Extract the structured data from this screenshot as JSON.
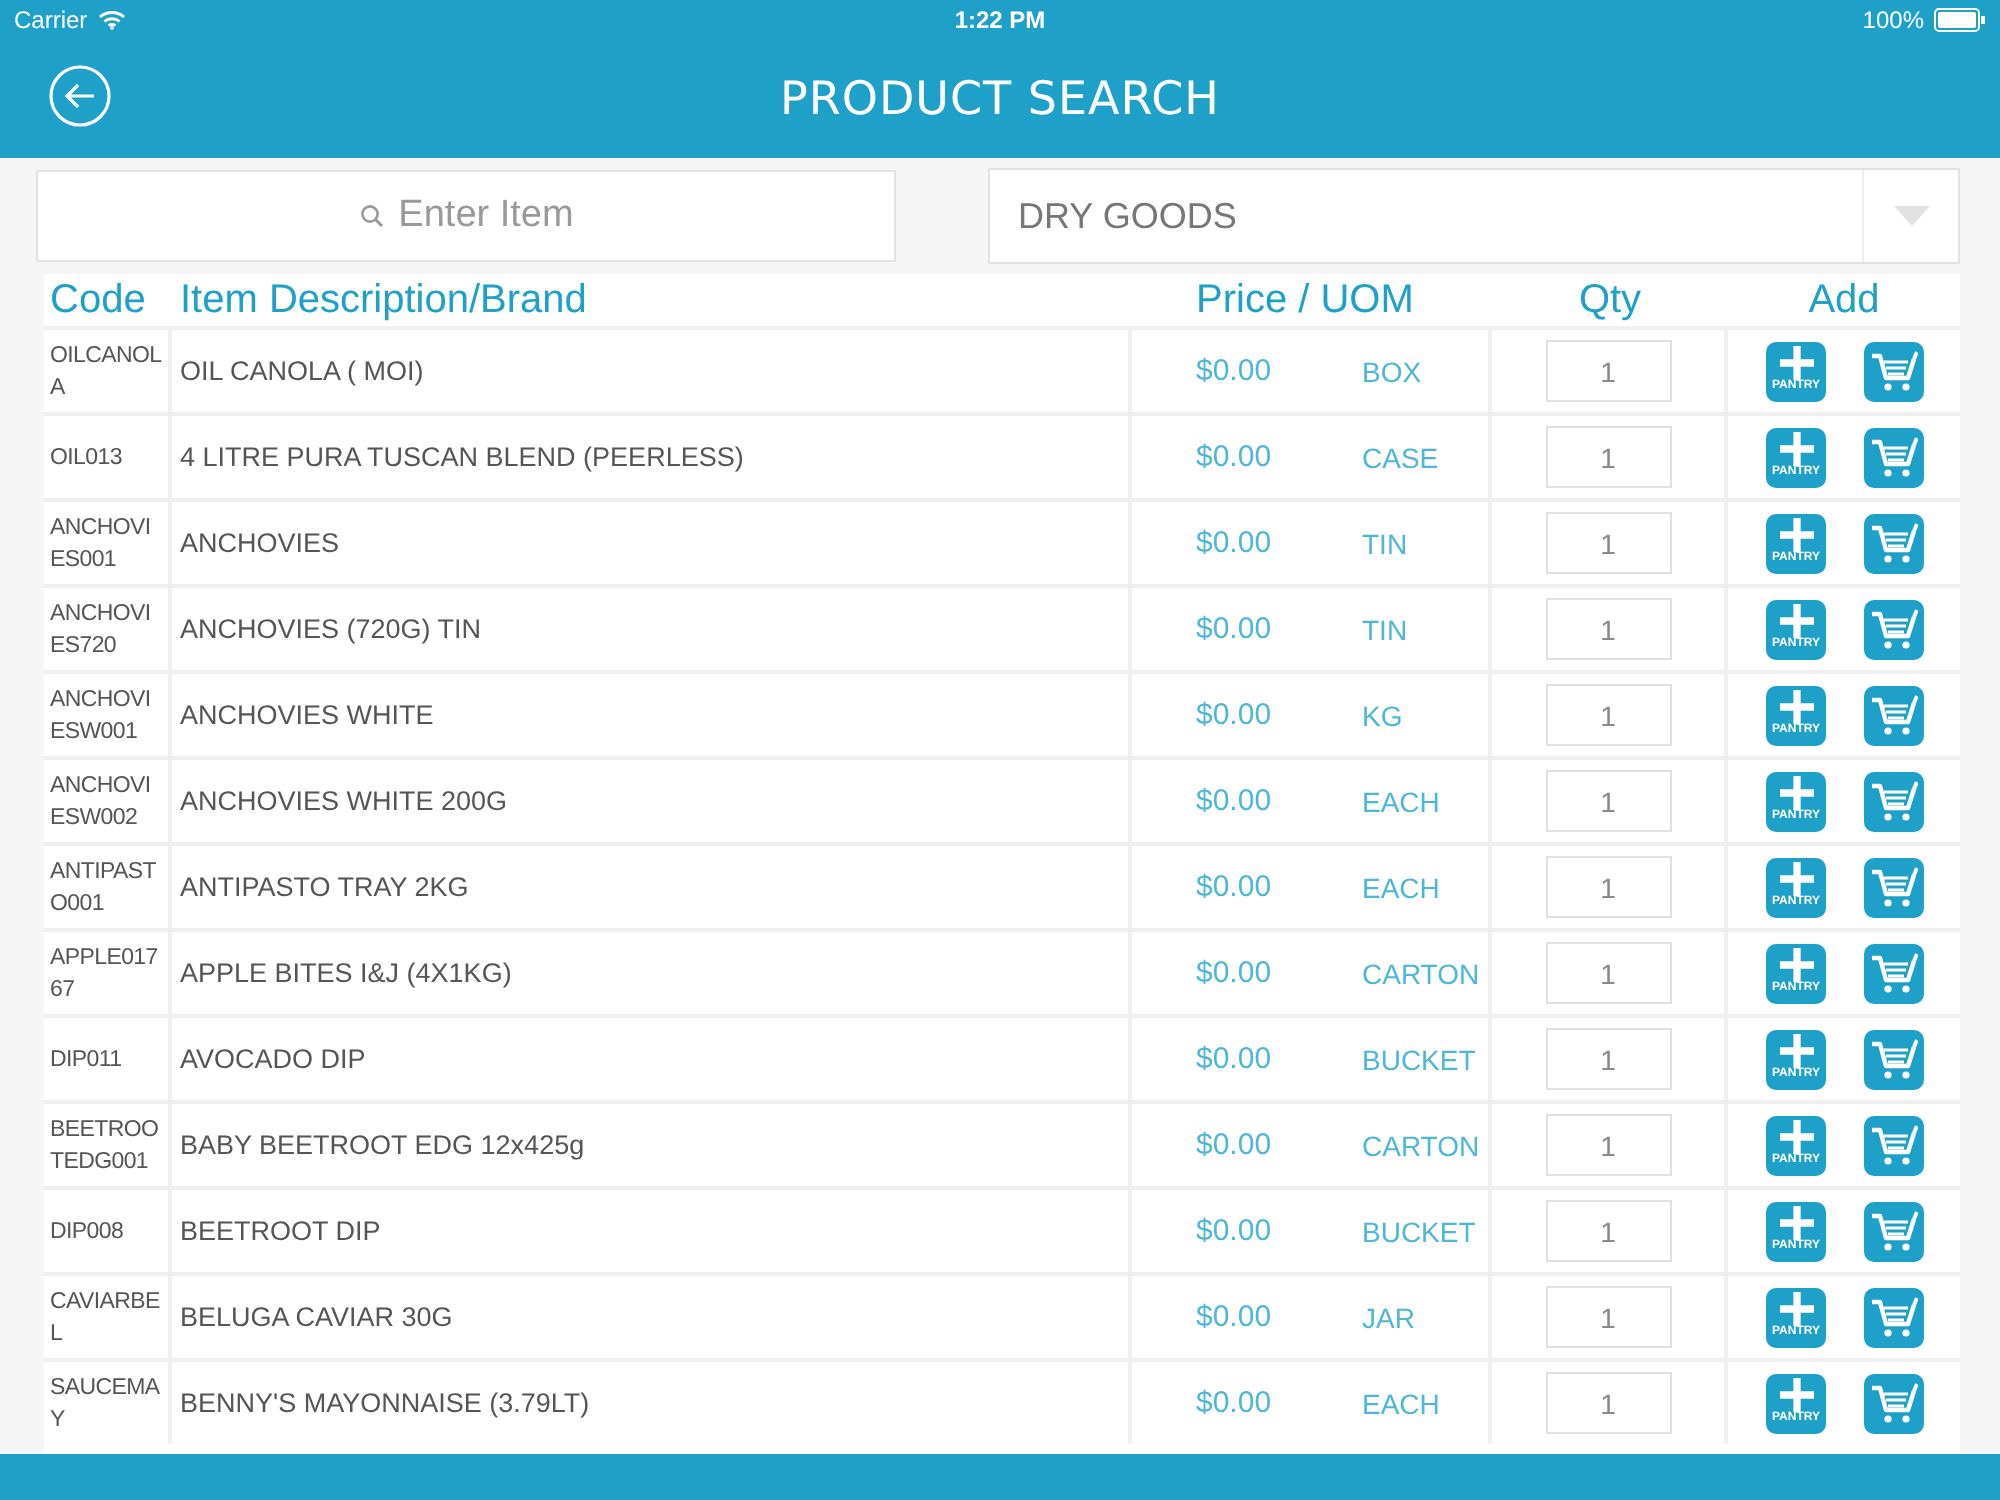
{
  "status_bar": {
    "carrier": "Carrier",
    "time": "1:22 PM",
    "battery": "100%"
  },
  "header": {
    "title": "PRODUCT SEARCH"
  },
  "search": {
    "placeholder": "Enter Item"
  },
  "category": {
    "value": "DRY GOODS"
  },
  "table": {
    "columns": [
      "Code",
      "Item Description/Brand",
      "Price / UOM",
      "Qty",
      "Add"
    ],
    "rows": [
      {
        "code": "OILCANOLA",
        "description": "OIL CANOLA ( MOI)",
        "price": "$0.00",
        "uom": "BOX",
        "qty": "1",
        "pantry": "PANTRY"
      },
      {
        "code": "OIL013",
        "description": "4 LITRE PURA TUSCAN BLEND (PEERLESS)",
        "price": "$0.00",
        "uom": "CASE",
        "qty": "1",
        "pantry": "PANTRY"
      },
      {
        "code": "ANCHOVIES001",
        "description": "ANCHOVIES",
        "price": "$0.00",
        "uom": "TIN",
        "qty": "1",
        "pantry": "PANTRY"
      },
      {
        "code": "ANCHOVIES720",
        "description": "ANCHOVIES (720G) TIN",
        "price": "$0.00",
        "uom": "TIN",
        "qty": "1",
        "pantry": "PANTRY"
      },
      {
        "code": "ANCHOVIESW001",
        "description": "ANCHOVIES WHITE",
        "price": "$0.00",
        "uom": "KG",
        "qty": "1",
        "pantry": "PANTRY"
      },
      {
        "code": "ANCHOVIESW002",
        "description": "ANCHOVIES WHITE 200G",
        "price": "$0.00",
        "uom": "EACH",
        "qty": "1",
        "pantry": "PANTRY"
      },
      {
        "code": "ANTIPASTO001",
        "description": "ANTIPASTO TRAY 2KG",
        "price": "$0.00",
        "uom": "EACH",
        "qty": "1",
        "pantry": "PANTRY"
      },
      {
        "code": "APPLE01767",
        "description": "APPLE BITES I&J (4X1KG)",
        "price": "$0.00",
        "uom": "CARTON",
        "qty": "1",
        "pantry": "PANTRY"
      },
      {
        "code": "DIP011",
        "description": "AVOCADO DIP",
        "price": "$0.00",
        "uom": "BUCKET",
        "qty": "1",
        "pantry": "PANTRY"
      },
      {
        "code": "BEETROOTEDG001",
        "description": "BABY BEETROOT EDG 12x425g",
        "price": "$0.00",
        "uom": "CARTON",
        "qty": "1",
        "pantry": "PANTRY"
      },
      {
        "code": "DIP008",
        "description": "BEETROOT DIP",
        "price": "$0.00",
        "uom": "BUCKET",
        "qty": "1",
        "pantry": "PANTRY"
      },
      {
        "code": "CAVIARBEL",
        "description": "BELUGA CAVIAR 30G",
        "price": "$0.00",
        "uom": "JAR",
        "qty": "1",
        "pantry": "PANTRY"
      },
      {
        "code": "SAUCEMAY",
        "description": "BENNY'S MAYONNAISE (3.79LT)",
        "price": "$0.00",
        "uom": "EACH",
        "qty": "1",
        "pantry": "PANTRY"
      }
    ]
  }
}
